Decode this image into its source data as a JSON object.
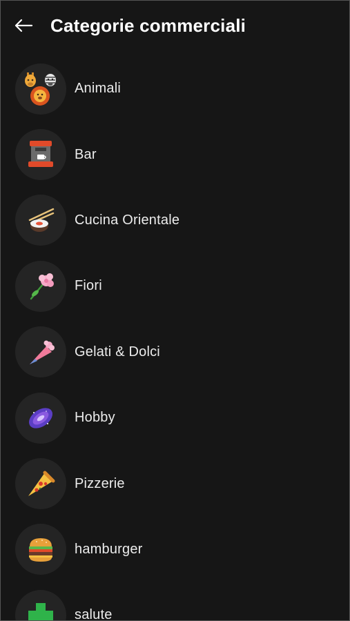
{
  "header": {
    "title": "Categorie commerciali",
    "back_icon": "arrow-left-icon"
  },
  "categories": [
    {
      "label": "Animali",
      "icon": "animals-icon"
    },
    {
      "label": "Bar",
      "icon": "coffee-machine-icon"
    },
    {
      "label": "Cucina Orientale",
      "icon": "sushi-chopsticks-icon"
    },
    {
      "label": "Fiori",
      "icon": "flower-icon"
    },
    {
      "label": "Gelati & Dolci",
      "icon": "piping-bag-icon"
    },
    {
      "label": "Hobby",
      "icon": "galaxy-icon"
    },
    {
      "label": "Pizzerie",
      "icon": "pizza-slice-icon"
    },
    {
      "label": "hamburger",
      "icon": "hamburger-icon"
    },
    {
      "label": "salute",
      "icon": "health-cross-icon"
    }
  ],
  "colors": {
    "background": "#161616",
    "avatar_background": "#242424",
    "text": "#ececec",
    "health_green": "#2fb34a"
  }
}
